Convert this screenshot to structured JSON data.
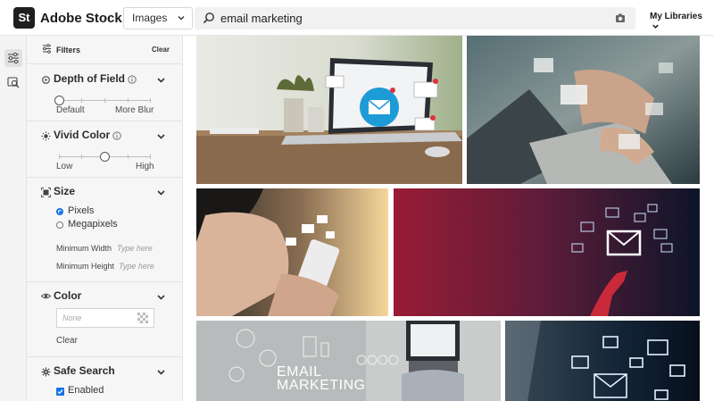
{
  "header": {
    "logo_text": "St",
    "brand": "Adobe Stock",
    "asset_type": "Images",
    "search_value": "email marketing",
    "libraries_label": "My Libraries"
  },
  "filters": {
    "title": "Filters",
    "clear": "Clear",
    "depth_of_field": {
      "title": "Depth of Field",
      "min_label": "Default",
      "max_label": "More Blur",
      "value": 0
    },
    "vivid_color": {
      "title": "Vivid Color",
      "min_label": "Low",
      "max_label": "High",
      "value": 0.5
    },
    "size": {
      "title": "Size",
      "options": [
        "Pixels",
        "Megapixels"
      ],
      "selected": "Pixels",
      "min_width_label": "Minimum Width",
      "min_width_placeholder": "Type here",
      "min_height_label": "Minimum Height",
      "min_height_placeholder": "Type here"
    },
    "color": {
      "title": "Color",
      "placeholder": "None",
      "clear": "Clear"
    },
    "safe_search": {
      "title": "Safe Search",
      "option": "Enabled",
      "checked": true
    }
  },
  "results": {
    "images": [
      {
        "subject": "laptop-email-notifications"
      },
      {
        "subject": "hands-typing-email-envelopes"
      },
      {
        "subject": "phone-email-icons"
      },
      {
        "subject": "red-wall-hand-email"
      },
      {
        "subject": "email-marketing-laptop-topdown",
        "caption_line1": "EMAIL",
        "caption_line2": "MARKETING"
      },
      {
        "subject": "dark-email-envelopes"
      }
    ]
  },
  "colors": {
    "accent": "#1473e6",
    "panel_bg": "#f6f6f6",
    "logo_bg": "#1f1f1f"
  }
}
